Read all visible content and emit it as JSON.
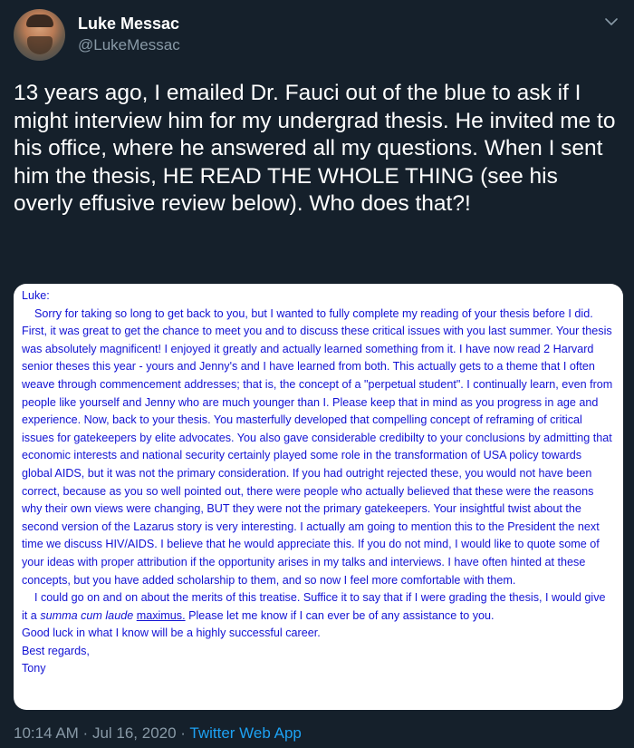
{
  "author": {
    "name": "Luke Messac",
    "handle": "@LukeMessac"
  },
  "tweet": {
    "text": "13 years ago, I emailed Dr. Fauci out of the blue to ask if I might interview him for my undergrad thesis. He invited me to his office, where he answered all my questions. When I sent him the thesis, HE READ THE WHOLE THING (see his overly effusive review below). Who does that?!"
  },
  "email": {
    "greeting": "Luke:",
    "paragraph1": "Sorry for taking so long to get back to you, but I wanted to fully complete my reading of your thesis before I did.  First, it was great to get the chance to meet you and to discuss these critical issues with you last summer.  Your thesis was absolutely magnificent!  I enjoyed it greatly and actually learned something from it.  I have now read 2 Harvard senior theses this year - yours and Jenny's and I have learned from both. This actually gets to a theme that I often weave through commencement addresses; that is, the concept of a \"perpetual student\".  I continually learn, even from people like yourself and Jenny who are much younger than I.  Please keep that in mind as you progress in age and experience.  Now, back to your thesis.  You masterfully developed that compelling concept of reframing of critical issues for gatekeepers  by elite advocates.  You also gave considerable credibilty to your conclusions by admitting that economic interests and national security certainly played some role in the transformation of USA policy towards global AIDS, but it was not the primary consideration.  If you had outright rejected these, you would not have been correct, because as you so well pointed out, there were people who actually believed that these were the reasons why their own views were changing, BUT they were not the primary gatekeepers.  Your insightful twist about the second version of the Lazarus story is very interesting.  I actually am going to mention this to the President the next time we discuss HIV/AIDS. I believe that he would appreciate this. If you do not mind, I would like to quote some of your ideas with proper attribution if the opportunity arises in my talks and interviews. I have often hinted at these concepts, but you have added scholarship to them, and so now I feel more comfortable with them.",
    "paragraph2_start": "I could go on and on about the merits of this treatise.  Suffice it to say that if I were grading the thesis, I would give it a ",
    "paragraph2_italic": "summa cum laude",
    "paragraph2_underline": "maximus.",
    "paragraph2_end": " Please let me know if I can ever be of any assistance to you.",
    "good_luck": "Good luck in what I know will be a highly successful career.",
    "closing": "Best regards,",
    "signature": "Tony"
  },
  "meta": {
    "time": "10:14 AM",
    "separator1": " · ",
    "date": "Jul 16, 2020",
    "separator2": " · ",
    "source": "Twitter Web App"
  },
  "icons": {
    "chevron": "chevron-down-icon"
  }
}
